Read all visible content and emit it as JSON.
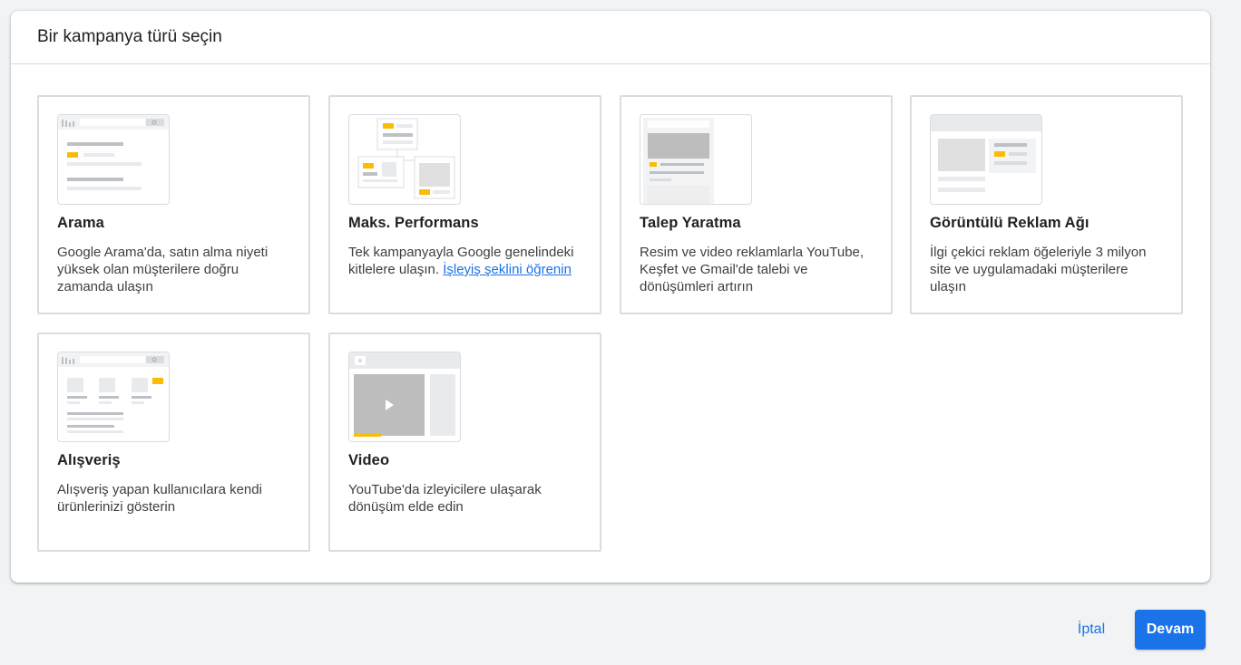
{
  "dialog": {
    "title": "Bir kampanya türü seçin"
  },
  "cards": [
    {
      "title": "Arama",
      "description": "Google Arama'da, satın alma niyeti yüksek olan müşterilere doğru zamanda ulaşın",
      "icon": "search-campaign-illustration-icon"
    },
    {
      "title": "Maks. Performans",
      "description": "Tek kampanyayla Google genelindeki kitlelere ulaşın. ",
      "link": "İşleyiş şeklini öğrenin",
      "icon": "performance-max-illustration-icon"
    },
    {
      "title": "Talep Yaratma",
      "description": "Resim ve video reklamlarla YouTube, Keşfet ve Gmail'de talebi ve dönüşümleri artırın",
      "icon": "demand-gen-illustration-icon"
    },
    {
      "title": "Görüntülü Reklam Ağı",
      "description": "İlgi çekici reklam öğeleriyle 3 milyon site ve uygulamadaki müşterilere ulaşın",
      "icon": "display-network-illustration-icon"
    },
    {
      "title": "Alışveriş",
      "description": "Alışveriş yapan kullanıcılara kendi ürünlerinizi gösterin",
      "icon": "shopping-illustration-icon"
    },
    {
      "title": "Video",
      "description": "YouTube'da izleyicilere ulaşarak dönüşüm elde edin",
      "icon": "video-illustration-icon"
    }
  ],
  "footer": {
    "cancel_label": "İptal",
    "continue_label": "Devam"
  },
  "colors": {
    "accent": "#1a73e8",
    "highlight_yellow": "#fbbc04",
    "placeholder_gray": "#dadce0",
    "background": "#f1f3f4"
  }
}
